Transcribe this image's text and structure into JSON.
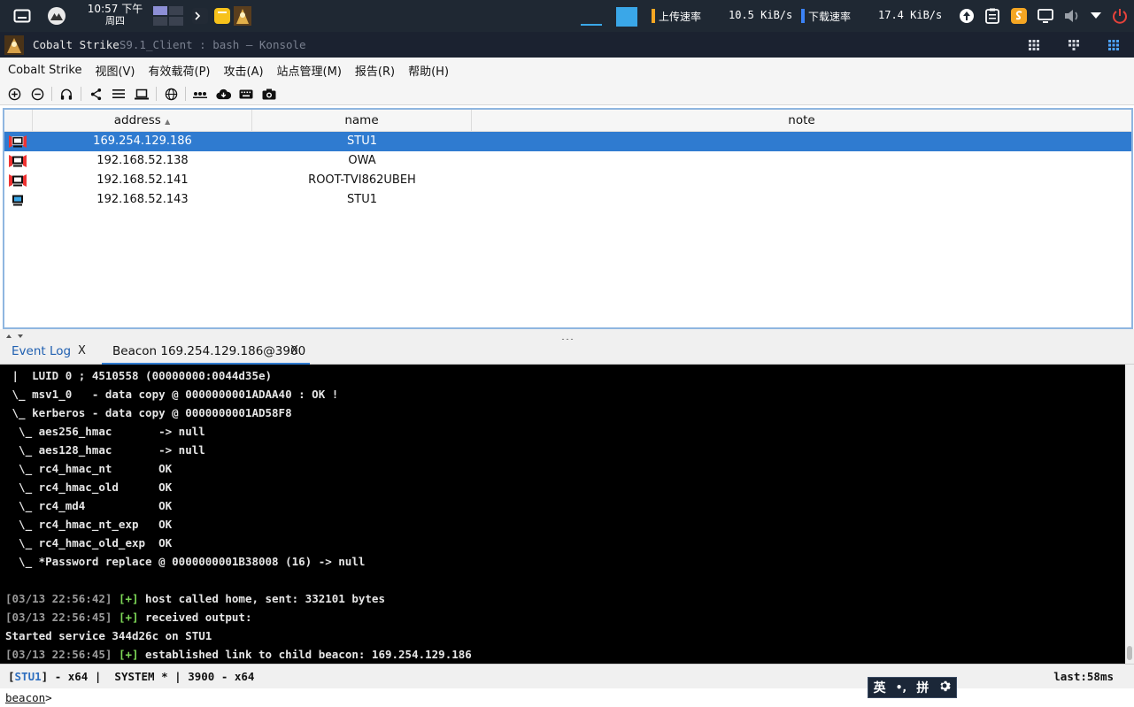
{
  "top_panel": {
    "clock_time": "10:57 下午",
    "clock_day": "周四",
    "upload_label": "上传速率",
    "upload_value": "10.5 KiB/s",
    "download_label": "下载速率",
    "download_value": "17.4 KiB/s"
  },
  "window": {
    "title_a": "Cobalt Strike",
    "title_b": "S",
    "title_c": "9.1_Client : bash — Konsole"
  },
  "menu": {
    "items": [
      "Cobalt Strike",
      "视图(V)",
      "有效载荷(P)",
      "攻击(A)",
      "站点管理(M)",
      "报告(R)",
      "帮助(H)"
    ]
  },
  "table": {
    "columns": [
      "address",
      "name",
      "note"
    ],
    "sort_indicator": "▲",
    "rows": [
      {
        "address": "169.254.129.186",
        "name": "STU1",
        "note": ""
      },
      {
        "address": "192.168.52.138",
        "name": "OWA",
        "note": ""
      },
      {
        "address": "192.168.52.141",
        "name": "ROOT-TVI862UBEH",
        "note": ""
      },
      {
        "address": "192.168.52.143",
        "name": "STU1",
        "note": ""
      }
    ]
  },
  "tabs": {
    "event_log": "Event Log",
    "event_log_close": "X",
    "beacon": "Beacon 169.254.129.186@3900",
    "beacon_close": "X"
  },
  "console": {
    "lines": [
      " |  LUID 0 ; 4510558 (00000000:0044d35e)",
      " \\_ msv1_0   - data copy @ 0000000001ADAA40 : OK !",
      " \\_ kerberos - data copy @ 0000000001AD58F8",
      "  \\_ aes256_hmac       -> null",
      "  \\_ aes128_hmac       -> null",
      "  \\_ rc4_hmac_nt       OK",
      "  \\_ rc4_hmac_old      OK",
      "  \\_ rc4_md4           OK",
      "  \\_ rc4_hmac_nt_exp   OK",
      "  \\_ rc4_hmac_old_exp  OK",
      "  \\_ *Password replace @ 0000000001B38008 (16) -> null"
    ],
    "log": [
      {
        "ts": "[03/13 22:56:42]",
        "tag": "[+]",
        "msg": " host called home, sent: 332101 bytes"
      },
      {
        "ts": "[03/13 22:56:45]",
        "tag": "[+]",
        "msg": " received output:"
      },
      {
        "ts": "",
        "tag": "",
        "msg": "Started service 344d26c on STU1"
      },
      {
        "ts": "[03/13 22:56:45]",
        "tag": "[+]",
        "msg": " established link to child beacon: 169.254.129.186"
      }
    ]
  },
  "status": {
    "bracket_open": "[",
    "host": "STU1",
    "rest": "] - x64 |  SYSTEM * | 3900 - x64",
    "last": "last:58ms"
  },
  "ime": {
    "lang": "英",
    "punct": "•,",
    "mode": "拼"
  },
  "input": {
    "prompt": "beacon",
    "suffix": ">"
  },
  "colors": {
    "selection": "#2f7bd0",
    "console_bg": "#000000",
    "success": "#7ed957",
    "upload_bar": "#f5a623",
    "download_bar": "#3b82f6"
  }
}
